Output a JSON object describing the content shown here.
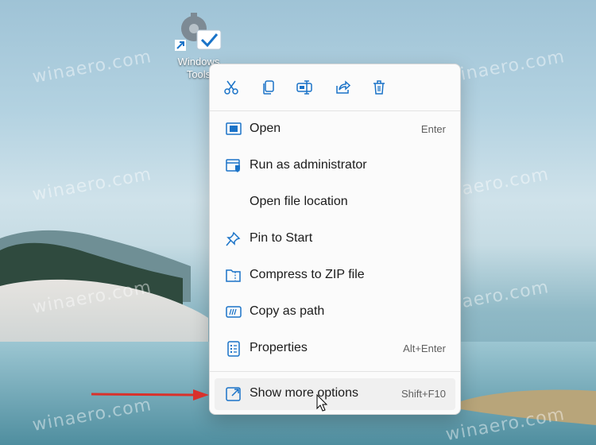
{
  "watermark": "winaero.com",
  "desktop_icon": {
    "label_line1": "Windows",
    "label_line2": "Tools"
  },
  "colors": {
    "accent": "#1a73c8",
    "arrow": "#d9312b",
    "menu_bg": "#fbfbfb"
  },
  "toolbar": {
    "icons": [
      "cut-icon",
      "copy-icon",
      "rename-icon",
      "share-icon",
      "delete-icon"
    ]
  },
  "menu": {
    "items": [
      {
        "label": "Open",
        "shortcut": "Enter",
        "icon": "window-icon"
      },
      {
        "label": "Run as administrator",
        "shortcut": "",
        "icon": "shield-window-icon"
      },
      {
        "label": "Open file location",
        "shortcut": "",
        "icon": ""
      },
      {
        "label": "Pin to Start",
        "shortcut": "",
        "icon": "pin-icon"
      },
      {
        "label": "Compress to ZIP file",
        "shortcut": "",
        "icon": "zip-folder-icon"
      },
      {
        "label": "Copy as path",
        "shortcut": "",
        "icon": "path-icon"
      },
      {
        "label": "Properties",
        "shortcut": "Alt+Enter",
        "icon": "properties-icon"
      },
      {
        "label": "Show more options",
        "shortcut": "Shift+F10",
        "icon": "more-options-icon"
      }
    ]
  }
}
